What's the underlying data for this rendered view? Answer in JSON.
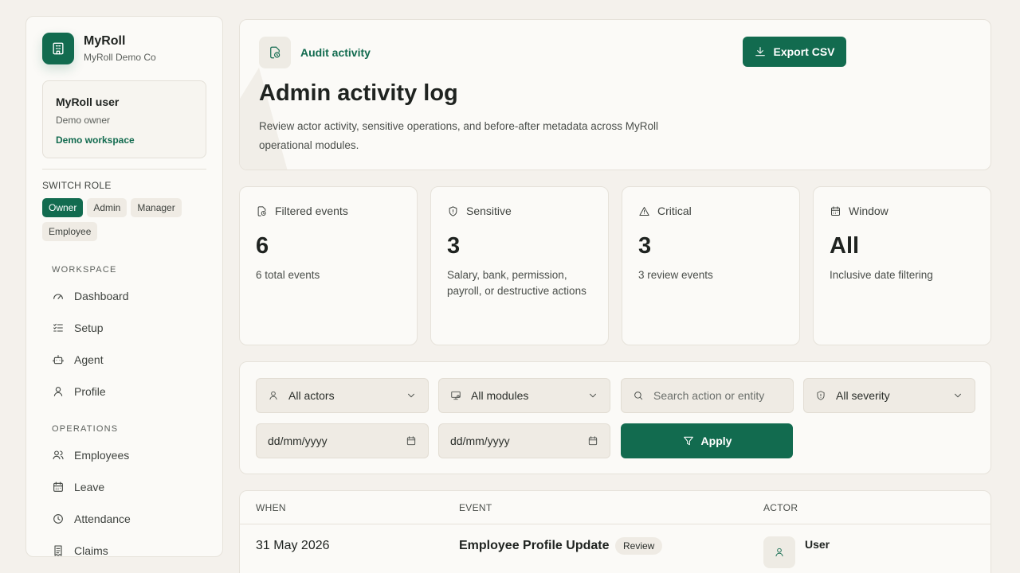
{
  "app": {
    "name": "MyRoll",
    "company": "MyRoll Demo Co"
  },
  "user": {
    "name": "MyRoll user",
    "role": "Demo owner",
    "workspace": "Demo workspace"
  },
  "switch_role": {
    "label": "SWITCH ROLE",
    "roles": [
      "Owner",
      "Admin",
      "Manager",
      "Employee"
    ],
    "active": "Owner"
  },
  "nav": {
    "workspace_label": "WORKSPACE",
    "workspace_items": [
      "Dashboard",
      "Setup",
      "Agent",
      "Profile"
    ],
    "operations_label": "OPERATIONS",
    "operations_items": [
      "Employees",
      "Leave",
      "Attendance",
      "Claims"
    ]
  },
  "header": {
    "eyebrow": "Audit activity",
    "title": "Admin activity log",
    "description": "Review actor activity, sensitive operations, and before-after metadata across MyRoll operational modules.",
    "export_label": "Export CSV"
  },
  "stats": [
    {
      "label": "Filtered events",
      "value": "6",
      "desc": "6 total events",
      "icon": "activity-icon"
    },
    {
      "label": "Sensitive",
      "value": "3",
      "desc": "Salary, bank, permission, payroll, or destructive actions",
      "icon": "shield-icon"
    },
    {
      "label": "Critical",
      "value": "3",
      "desc": "3 review events",
      "icon": "warning-icon"
    },
    {
      "label": "Window",
      "value": "All",
      "desc": "Inclusive date filtering",
      "icon": "calendar-icon"
    }
  ],
  "filters": {
    "actor": "All actors",
    "module": "All modules",
    "search_placeholder": "Search action or entity",
    "severity": "All severity",
    "date_from": "dd/mm/yyyy",
    "date_to": "dd/mm/yyyy",
    "apply_label": "Apply"
  },
  "table": {
    "columns": [
      "WHEN",
      "EVENT",
      "ACTOR"
    ],
    "rows": [
      {
        "when": "31 May 2026",
        "event": "Employee Profile Update",
        "badge": "Review",
        "actor": "User"
      }
    ]
  },
  "colors": {
    "accent": "#126b4f",
    "background": "#f4f1ec",
    "surface": "#fbfaf7"
  }
}
